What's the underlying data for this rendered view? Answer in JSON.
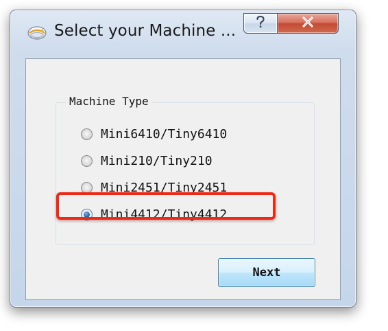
{
  "window": {
    "title": "Select your Machine ...",
    "icons": {
      "app": "app-icon",
      "help": "help-icon",
      "close": "close-icon"
    }
  },
  "group": {
    "legend": "Machine Type",
    "options": [
      {
        "label": "Mini6410/Tiny6410",
        "checked": false
      },
      {
        "label": "Mini210/Tiny210",
        "checked": false
      },
      {
        "label": "Mini2451/Tiny2451",
        "checked": false
      },
      {
        "label": "Mini4412/Tiny4412",
        "checked": true
      }
    ]
  },
  "buttons": {
    "next": "Next"
  },
  "annotation": {
    "highlight_color": "#ee2a17"
  }
}
